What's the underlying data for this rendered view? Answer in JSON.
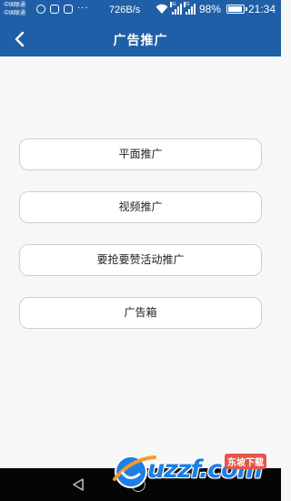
{
  "status_bar": {
    "carrier_1": "中国联通",
    "carrier_2": "中国联通",
    "overflow": "···",
    "net_speed": "726B/s",
    "network_4g": "4G",
    "network_2g": "2G",
    "battery_percent": "98%",
    "battery_level": 0.98,
    "time": "21:34"
  },
  "header": {
    "title": "广告推广",
    "background_color": "#1f5fa8"
  },
  "menu": {
    "items": [
      {
        "label": "平面推广"
      },
      {
        "label": "视频推广"
      },
      {
        "label": "要抢要赞活动推广"
      },
      {
        "label": "广告箱"
      }
    ]
  },
  "watermark": {
    "site": "uzzf.com",
    "tagline": "东坡下载"
  }
}
